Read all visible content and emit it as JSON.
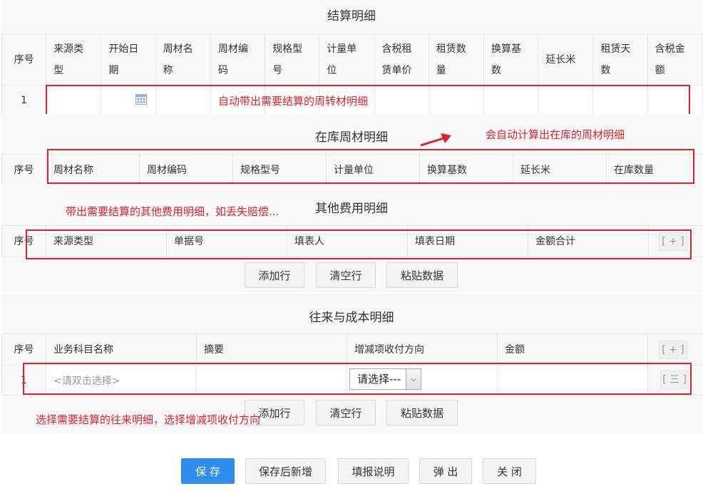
{
  "settlement": {
    "title": "结算明细",
    "headers": [
      "序号",
      "来源类型",
      "开始日期",
      "周材名称",
      "周材编码",
      "规格型号",
      "计量单位",
      "含税租赁单价",
      "租赁数量",
      "换算基数",
      "延长米",
      "租赁天数",
      "含税金额"
    ],
    "headers_wrapped": [
      [
        "序号"
      ],
      [
        "来源类",
        "型"
      ],
      [
        "开始日",
        "期"
      ],
      [
        "周材名",
        "称"
      ],
      [
        "周材编",
        "码"
      ],
      [
        "规格型",
        "号"
      ],
      [
        "计量单",
        "位"
      ],
      [
        "含税租",
        "赁单价"
      ],
      [
        "租赁数",
        "量"
      ],
      [
        "换算基",
        "数"
      ],
      [
        "延长米"
      ],
      [
        "租赁天",
        "数"
      ],
      [
        "含税金",
        "额"
      ]
    ],
    "row_index": "1",
    "annotation": "自动带出需要结算的周转材明细"
  },
  "stock": {
    "title": "在库周材明细",
    "headers": [
      "序号",
      "周材名称",
      "周材编码",
      "规格型号",
      "计量单位",
      "换算基数",
      "延长米",
      "在库数量"
    ],
    "annotation": "会自动计算出在库的周材明细"
  },
  "other_fees": {
    "title": "其他费用明细",
    "annotation": "带出需要结算的其他费用明细，如丢失赔偿...",
    "headers": [
      "序号",
      "来源类型",
      "单据号",
      "填表人",
      "填表日期",
      "金额合计"
    ],
    "add_label": "[ + ]",
    "buttons": [
      "添加行",
      "清空行",
      "粘贴数据"
    ]
  },
  "cost": {
    "title": "往来与成本明细",
    "headers": [
      "序号",
      "业务科目名称",
      "摘要",
      "增减项收付方向",
      "金额"
    ],
    "add_label": "[ + ]",
    "row_index": "1",
    "subject_placeholder": "<请双击选择>",
    "direction_select": "请选择---",
    "row_action": "[ 三 ]",
    "annotation": "选择需要结算的往来明细，选择增减项收付方向",
    "buttons": [
      "添加行",
      "清空行",
      "粘贴数据"
    ]
  },
  "footer": {
    "buttons": [
      "保 存",
      "保存后新增",
      "填报说明",
      "弹 出",
      "关 闭"
    ],
    "primary_color": "#2e8ded"
  },
  "annotation_color": "#e0202c"
}
